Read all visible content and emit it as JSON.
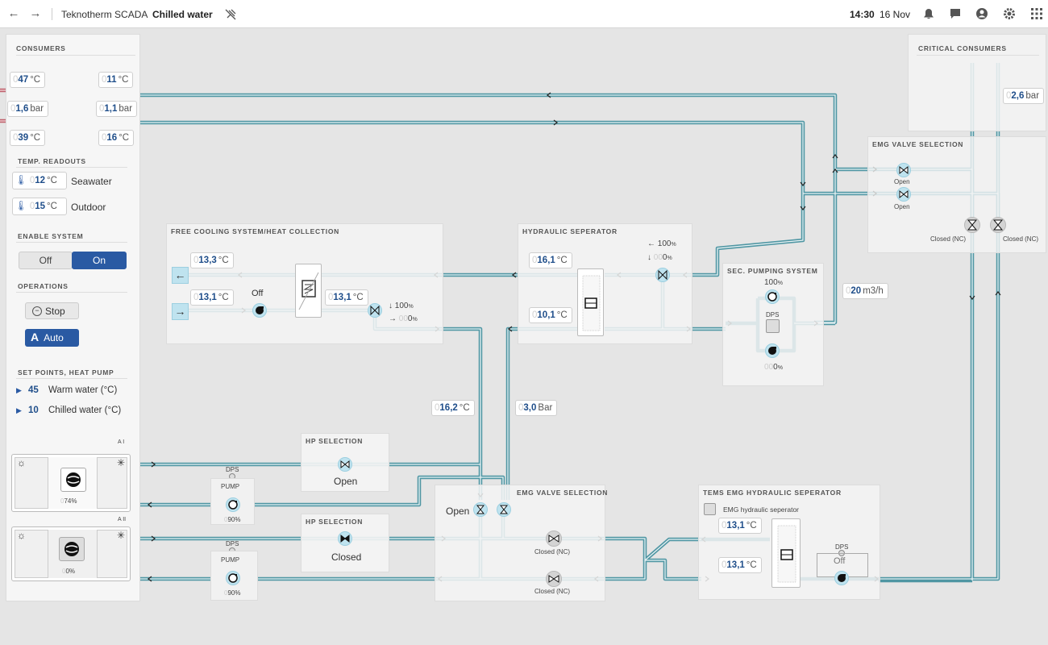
{
  "header": {
    "app": "Teknotherm SCADA",
    "page": "Chilled water",
    "time": "14:30",
    "date": "16 Nov"
  },
  "consumers": {
    "title": "CONSUMERS",
    "left": [
      {
        "v": "47",
        "u": "°C"
      },
      {
        "v": "1,6",
        "u": "bar"
      },
      {
        "v": "39",
        "u": "°C"
      }
    ],
    "right": [
      {
        "v": "11",
        "u": "°C"
      },
      {
        "v": "1,1",
        "u": "bar"
      },
      {
        "v": "16",
        "u": "°C"
      }
    ]
  },
  "temp": {
    "title": "TEMP. READOUTS",
    "seawater": {
      "v": "12",
      "u": "°C",
      "label": "Seawater"
    },
    "outdoor": {
      "v": "15",
      "u": "°C",
      "label": "Outdoor"
    }
  },
  "enable": {
    "title": "ENABLE SYSTEM",
    "off": "Off",
    "on": "On"
  },
  "operations": {
    "title": "OPERATIONS",
    "stop": "Stop",
    "auto": "Auto",
    "auto_icon": "A"
  },
  "setpoints": {
    "title": "SET POINTS, HEAT PUMP",
    "items": [
      {
        "v": "45",
        "label": "Warm water (°C)"
      },
      {
        "v": "10",
        "label": "Chilled water (°C)"
      }
    ]
  },
  "heatpumps": [
    {
      "pct": "74",
      "unit": "%"
    },
    {
      "pct": "0",
      "unit": "%"
    }
  ],
  "hp_corner": [
    "A I",
    "A II"
  ],
  "pumps": [
    {
      "dps": "DPS",
      "label": "PUMP",
      "pct": "90",
      "unit": "%"
    },
    {
      "dps": "DPS",
      "label": "PUMP",
      "pct": "90",
      "unit": "%"
    }
  ],
  "free_cooling": {
    "title": "FREE COOLING SYSTEM/HEAT COLLECTION",
    "t1": {
      "v": "13,3",
      "u": "°C"
    },
    "t2": {
      "v": "13,1",
      "u": "°C"
    },
    "t3": {
      "v": "13,1",
      "u": "°C"
    },
    "pump_state": "Off",
    "pct_a": "100",
    "pct_b": "0",
    "unit": "%"
  },
  "hydraulic": {
    "title": "HYDRAULIC SEPERATOR",
    "t1": {
      "v": "16,1",
      "u": "°C"
    },
    "t2": {
      "v": "10,1",
      "u": "°C"
    },
    "pct_a": "100",
    "pct_b": "0",
    "unit": "%"
  },
  "sec_pumping": {
    "title": "SEC. PUMPING SYSTEM",
    "pct_top": "100",
    "pct_bot": "0",
    "unit": "%",
    "dps": "DPS",
    "flow": {
      "v": "20",
      "u": "m3/h"
    }
  },
  "critical": {
    "title": "CRITICAL CONSUMERS",
    "pressure": {
      "v": "2,6",
      "u": "bar"
    }
  },
  "emg_valve_top": {
    "title": "EMG VALVE SELECTION",
    "open1": "Open",
    "open2": "Open",
    "closed1": "Closed (NC)",
    "closed2": "Closed (NC)"
  },
  "mid_readouts": {
    "temp": {
      "v": "16,2",
      "u": "°C"
    },
    "pressure": {
      "v": "3,0",
      "u": "Bar"
    }
  },
  "hp_sel_1": {
    "title": "HP SELECTION",
    "state": "Open"
  },
  "hp_sel_2": {
    "title": "HP SELECTION",
    "state": "Closed"
  },
  "emg_valve_bottom": {
    "title": "EMG VALVE SELECTION",
    "open": "Open",
    "closed1": "Closed (NC)",
    "closed2": "Closed (NC)"
  },
  "tems": {
    "title": "TEMS EMG HYDRAULIC SEPERATOR",
    "checkbox": "EMG hydraulic seperator",
    "t1": {
      "v": "13,1",
      "u": "°C"
    },
    "t2": {
      "v": "13,1",
      "u": "°C"
    },
    "dps": "DPS",
    "state": "Off"
  },
  "colors": {
    "pipe": "#5b9ea8",
    "hot": "#c0616d",
    "accent": "#2a5aa3",
    "panel": "#f4f4f4"
  }
}
